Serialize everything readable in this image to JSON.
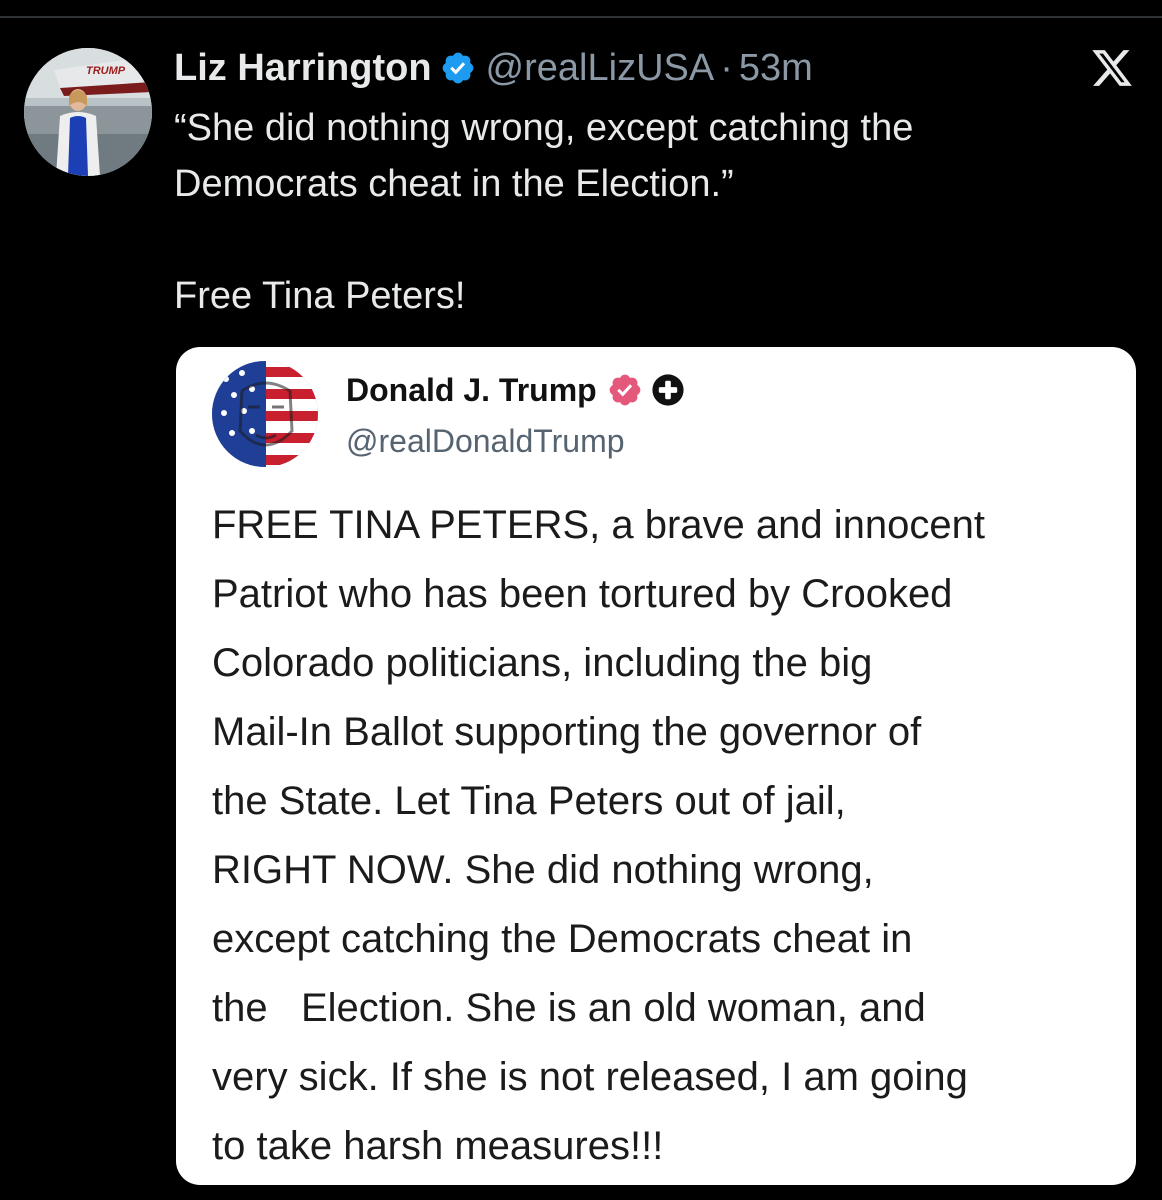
{
  "tweet": {
    "author": {
      "display_name": "Liz Harrington",
      "handle": "@realLizUSA",
      "verified_color": "#1d9bf0",
      "avatar_sign_text": "TRUMP"
    },
    "separator": "·",
    "time": "53m",
    "text": "“She did nothing wrong, except catching the\nDemocrats cheat in the Election.”\n\nFree Tina Peters!",
    "platform_icon": "x-logo-icon"
  },
  "quote": {
    "author": {
      "display_name": "Donald J. Trump",
      "handle": "@realDonaldTrump",
      "verified_color": "#e4587c"
    },
    "text": "FREE TINA PETERS, a brave and innocent\nPatriot who has been tortured by Crooked\nColorado politicians, including the big\nMail-In Ballot supporting the governor of\nthe State. Let Tina Peters out of jail,\nRIGHT NOW. She did nothing wrong,\nexcept catching the Democrats cheat in\nthe   Election. She is an old woman, and\nvery sick. If she is not released, I am going\nto take harsh measures!!!"
  },
  "colors": {
    "background": "#000000",
    "text_primary": "#e7e9ea",
    "text_secondary": "#8b98a5",
    "card_background": "#ffffff"
  }
}
